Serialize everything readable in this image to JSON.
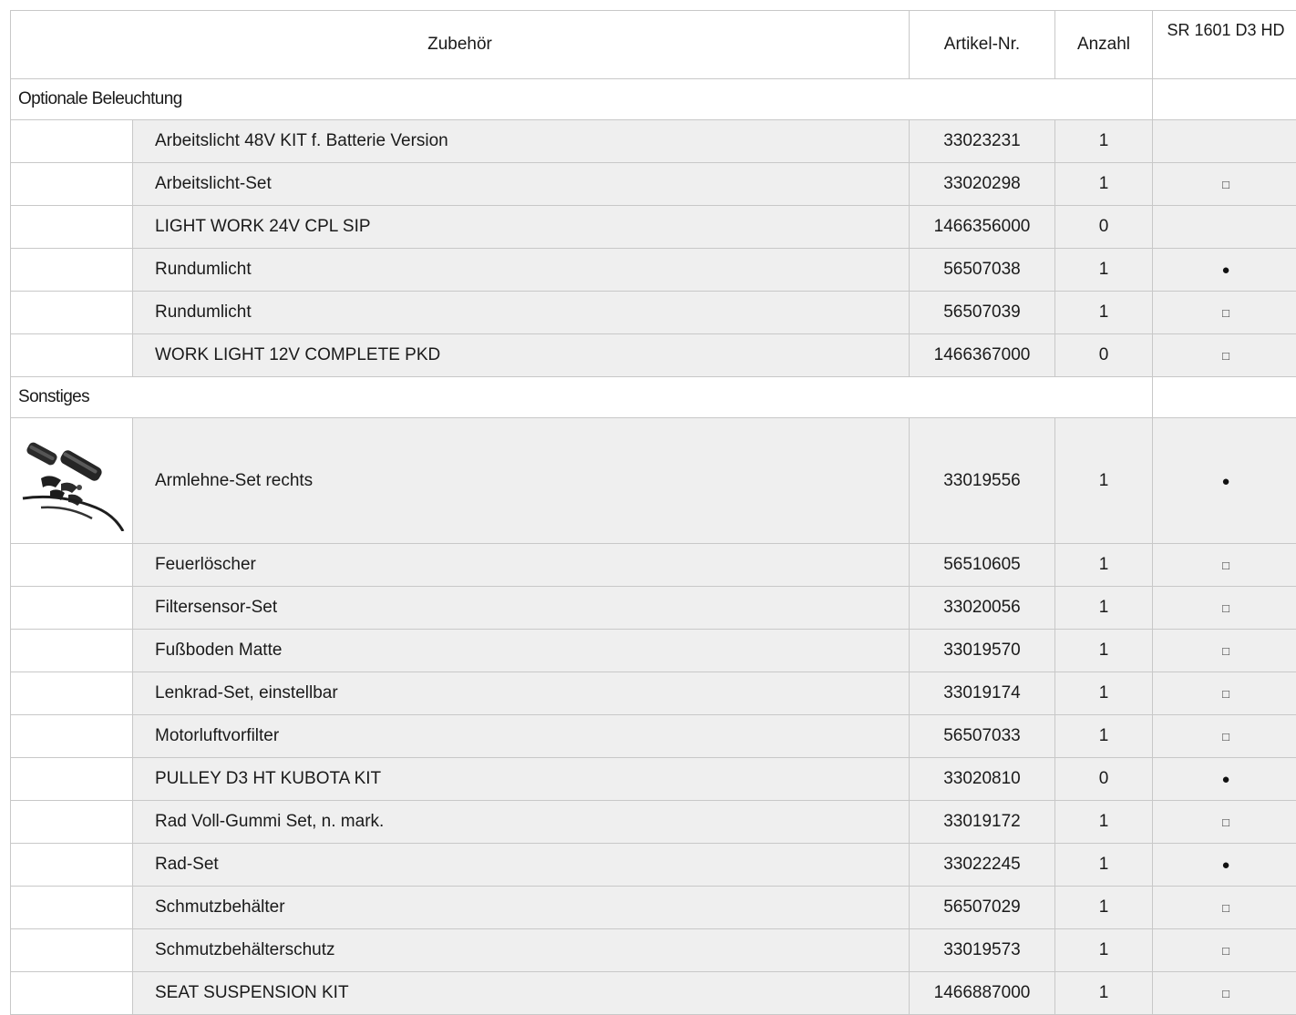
{
  "header": {
    "col_accessory": "Zubehör",
    "col_article": "Artikel-Nr.",
    "col_quantity": "Anzahl",
    "col_model": "SR 1601 D3 HD"
  },
  "legend_symbols": {
    "standard": "●",
    "optional": "□"
  },
  "groups": [
    {
      "title": "Optionale Beleuchtung",
      "items": [
        {
          "name": "Arbeitslicht 48V KIT f. Batterie Version",
          "article": "33023231",
          "qty": "1",
          "model": ""
        },
        {
          "name": "Arbeitslicht-Set",
          "article": "33020298",
          "qty": "1",
          "model": "□"
        },
        {
          "name": "LIGHT WORK 24V CPL SIP",
          "article": "1466356000",
          "qty": "0",
          "model": ""
        },
        {
          "name": "Rundumlicht",
          "article": "56507038",
          "qty": "1",
          "model": "●"
        },
        {
          "name": "Rundumlicht",
          "article": "56507039",
          "qty": "1",
          "model": "□"
        },
        {
          "name": "WORK LIGHT 12V COMPLETE PKD",
          "article": "1466367000",
          "qty": "0",
          "model": "□"
        }
      ]
    },
    {
      "title": "Sonstiges",
      "items": [
        {
          "name": "Armlehne-Set rechts",
          "article": "33019556",
          "qty": "1",
          "model": "●",
          "has_image": true
        },
        {
          "name": "Feuerlöscher",
          "article": "56510605",
          "qty": "1",
          "model": "□"
        },
        {
          "name": "Filtersensor-Set",
          "article": "33020056",
          "qty": "1",
          "model": "□"
        },
        {
          "name": "Fußboden Matte",
          "article": "33019570",
          "qty": "1",
          "model": "□"
        },
        {
          "name": "Lenkrad-Set, einstellbar",
          "article": "33019174",
          "qty": "1",
          "model": "□"
        },
        {
          "name": "Motorluftvorfilter",
          "article": "56507033",
          "qty": "1",
          "model": "□"
        },
        {
          "name": "PULLEY D3 HT KUBOTA KIT",
          "article": "33020810",
          "qty": "0",
          "model": "●"
        },
        {
          "name": "Rad Voll-Gummi Set, n. mark.",
          "article": "33019172",
          "qty": "1",
          "model": "□"
        },
        {
          "name": "Rad-Set",
          "article": "33022245",
          "qty": "1",
          "model": "●"
        },
        {
          "name": "Schmutzbehälter",
          "article": "56507029",
          "qty": "1",
          "model": "□"
        },
        {
          "name": "Schmutzbehälterschutz",
          "article": "33019573",
          "qty": "1",
          "model": "□"
        },
        {
          "name": "SEAT SUSPENSION KIT",
          "article": "1466887000",
          "qty": "1",
          "model": "□"
        }
      ]
    }
  ]
}
